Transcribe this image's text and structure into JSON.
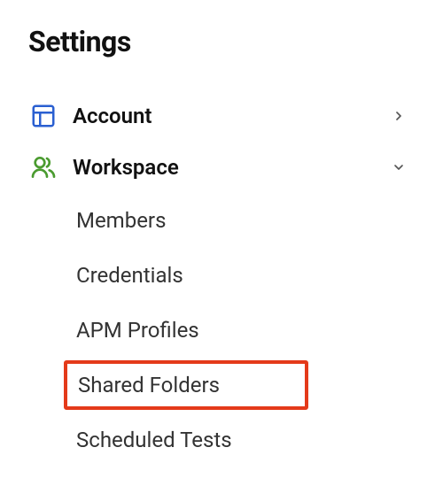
{
  "title": "Settings",
  "nav": {
    "account": {
      "label": "Account"
    },
    "workspace": {
      "label": "Workspace",
      "items": [
        {
          "label": "Members"
        },
        {
          "label": "Credentials"
        },
        {
          "label": "APM Profiles"
        },
        {
          "label": "Shared Folders"
        },
        {
          "label": "Scheduled Tests"
        }
      ]
    }
  },
  "colors": {
    "account_icon": "#2a5fd1",
    "workspace_icon": "#4a9b2f",
    "highlight": "#e43a1a"
  }
}
